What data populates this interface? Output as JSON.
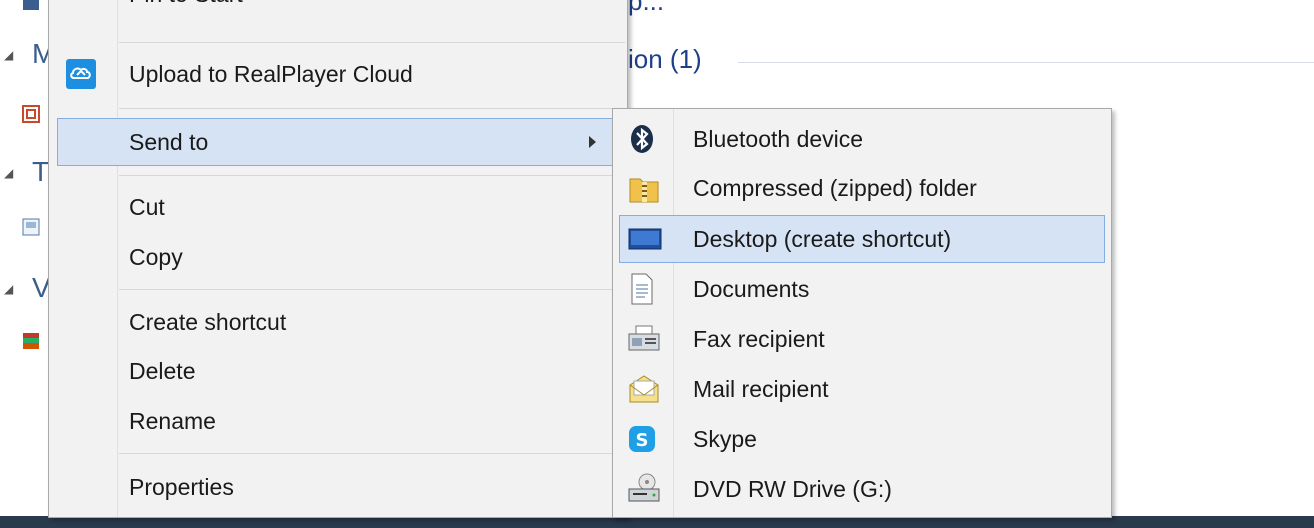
{
  "background": {
    "top_text": "p...",
    "group_header": "ion (1)",
    "letters": [
      "M",
      "T",
      "V"
    ]
  },
  "main_menu": {
    "items": [
      {
        "label": "Pin to Start",
        "icon": "none"
      },
      {
        "label": "Upload to RealPlayer Cloud",
        "icon": "realplayer-cloud-icon"
      },
      {
        "label": "Send to",
        "icon": "none",
        "submenu": true
      },
      {
        "label": "Cut"
      },
      {
        "label": "Copy"
      },
      {
        "label": "Create shortcut"
      },
      {
        "label": "Delete"
      },
      {
        "label": "Rename"
      },
      {
        "label": "Properties"
      }
    ]
  },
  "send_to_menu": {
    "items": [
      {
        "label": "Bluetooth device",
        "icon": "bluetooth-icon"
      },
      {
        "label": "Compressed (zipped) folder",
        "icon": "zip-folder-icon"
      },
      {
        "label": "Desktop (create shortcut)",
        "icon": "desktop-icon",
        "highlighted": true
      },
      {
        "label": "Documents",
        "icon": "document-icon"
      },
      {
        "label": "Fax recipient",
        "icon": "fax-icon"
      },
      {
        "label": "Mail recipient",
        "icon": "mail-icon"
      },
      {
        "label": "Skype",
        "icon": "skype-icon"
      },
      {
        "label": "DVD RW Drive (G:)",
        "icon": "dvd-drive-icon"
      }
    ]
  },
  "colors": {
    "highlight_bg": "#d5e3f5",
    "highlight_border": "#84aee3",
    "menu_bg": "#f2f2f2"
  }
}
